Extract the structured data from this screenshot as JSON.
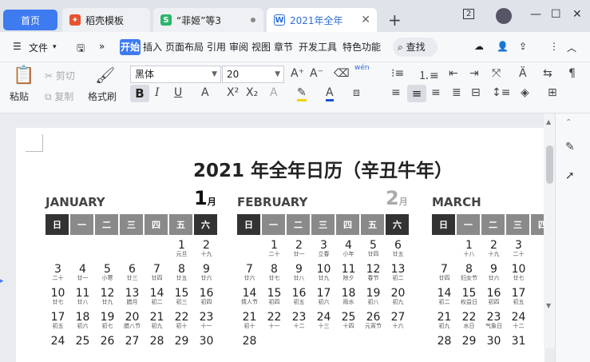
{
  "tabs": {
    "home": "首页",
    "t2": "稻壳模板",
    "t3": "“菲姬”等3",
    "t4": "2021年全年"
  },
  "window": {
    "badge": "2"
  },
  "toolbar1": {
    "file": "文件",
    "menus": [
      "开始",
      "插入",
      "页面布局",
      "引用",
      "审阅",
      "视图",
      "章节",
      "开发工具",
      "特色功能"
    ],
    "search": "查找"
  },
  "toolbar2": {
    "paste": "粘贴",
    "cut": "剪切",
    "copy": "复制",
    "format_painter": "格式刷",
    "font": "黑体",
    "size": "20",
    "pinyin": "wén"
  },
  "doc": {
    "title": "2021 年全年日历（辛丑牛年）",
    "weekdays": [
      "日",
      "一",
      "二",
      "三",
      "四",
      "五",
      "六"
    ]
  },
  "months": [
    {
      "name": "JANUARY",
      "num": "1",
      "unit": "月",
      "weeks": [
        [
          [
            "",
            ""
          ],
          [
            "",
            ""
          ],
          [
            "",
            ""
          ],
          [
            "",
            ""
          ],
          [
            "",
            ""
          ],
          [
            "1",
            "元旦"
          ],
          [
            "2",
            "十九"
          ]
        ],
        [
          [
            "3",
            "二十"
          ],
          [
            "4",
            "廿一"
          ],
          [
            "5",
            "小寒"
          ],
          [
            "6",
            "廿三"
          ],
          [
            "7",
            "廿四"
          ],
          [
            "8",
            "廿五"
          ],
          [
            "9",
            "廿六"
          ]
        ],
        [
          [
            "10",
            "廿七"
          ],
          [
            "11",
            "廿八"
          ],
          [
            "12",
            "廿九"
          ],
          [
            "13",
            "腊月"
          ],
          [
            "14",
            "初二"
          ],
          [
            "15",
            "初三"
          ],
          [
            "16",
            "初四"
          ]
        ],
        [
          [
            "17",
            "初五"
          ],
          [
            "18",
            "初六"
          ],
          [
            "19",
            "初七"
          ],
          [
            "20",
            "腊八节"
          ],
          [
            "21",
            "初九"
          ],
          [
            "22",
            "初十"
          ],
          [
            "23",
            "十一"
          ]
        ],
        [
          [
            "24",
            ""
          ],
          [
            "25",
            ""
          ],
          [
            "26",
            ""
          ],
          [
            "27",
            ""
          ],
          [
            "28",
            ""
          ],
          [
            "29",
            ""
          ],
          [
            "30",
            ""
          ]
        ]
      ]
    },
    {
      "name": "FEBRUARY",
      "num": "2",
      "unit": "月",
      "weeks": [
        [
          [
            "",
            ""
          ],
          [
            "1",
            "二十"
          ],
          [
            "2",
            "廿一"
          ],
          [
            "3",
            "立春"
          ],
          [
            "4",
            "小年"
          ],
          [
            "5",
            "廿四"
          ],
          [
            "6",
            "廿五"
          ]
        ],
        [
          [
            "7",
            "廿六"
          ],
          [
            "8",
            "廿七"
          ],
          [
            "9",
            "廿八"
          ],
          [
            "10",
            "廿九"
          ],
          [
            "11",
            "除夕"
          ],
          [
            "12",
            "春节"
          ],
          [
            "13",
            "初二"
          ]
        ],
        [
          [
            "14",
            "情人节"
          ],
          [
            "15",
            "初四"
          ],
          [
            "16",
            "初五"
          ],
          [
            "17",
            "初六"
          ],
          [
            "18",
            "雨水"
          ],
          [
            "19",
            "初八"
          ],
          [
            "20",
            "初九"
          ]
        ],
        [
          [
            "21",
            "初十"
          ],
          [
            "22",
            "十一"
          ],
          [
            "23",
            "十二"
          ],
          [
            "24",
            "十三"
          ],
          [
            "25",
            "十四"
          ],
          [
            "26",
            "元宵节"
          ],
          [
            "27",
            "十六"
          ]
        ],
        [
          [
            "28",
            ""
          ],
          [
            "",
            ""
          ],
          [
            "",
            ""
          ],
          [
            "",
            ""
          ],
          [
            "",
            ""
          ],
          [
            "",
            ""
          ],
          [
            "",
            ""
          ]
        ]
      ]
    },
    {
      "name": "MARCH",
      "num": "",
      "unit": "",
      "weeks": [
        [
          [
            "",
            ""
          ],
          [
            "1",
            "十八"
          ],
          [
            "2",
            "十九"
          ],
          [
            "3",
            "二十"
          ],
          [
            "",
            ""
          ],
          [
            "",
            ""
          ],
          [
            "",
            ""
          ]
        ],
        [
          [
            "7",
            "廿四"
          ],
          [
            "8",
            "妇女节"
          ],
          [
            "9",
            "廿六"
          ],
          [
            "10",
            "廿七"
          ],
          [
            "",
            ""
          ],
          [
            "",
            ""
          ],
          [
            "",
            ""
          ]
        ],
        [
          [
            "14",
            "初二"
          ],
          [
            "15",
            "权益日"
          ],
          [
            "16",
            "初四"
          ],
          [
            "17",
            "初五"
          ],
          [
            "",
            ""
          ],
          [
            "",
            ""
          ],
          [
            "",
            ""
          ]
        ],
        [
          [
            "21",
            "初九"
          ],
          [
            "22",
            "水日"
          ],
          [
            "23",
            "气象日"
          ],
          [
            "24",
            "十二"
          ],
          [
            "",
            ""
          ],
          [
            "",
            ""
          ],
          [
            "",
            ""
          ]
        ],
        [
          [
            "28",
            ""
          ],
          [
            "29",
            ""
          ],
          [
            "30",
            ""
          ],
          [
            "31",
            ""
          ],
          [
            "",
            ""
          ],
          [
            "",
            ""
          ],
          [
            "",
            ""
          ]
        ]
      ]
    }
  ]
}
